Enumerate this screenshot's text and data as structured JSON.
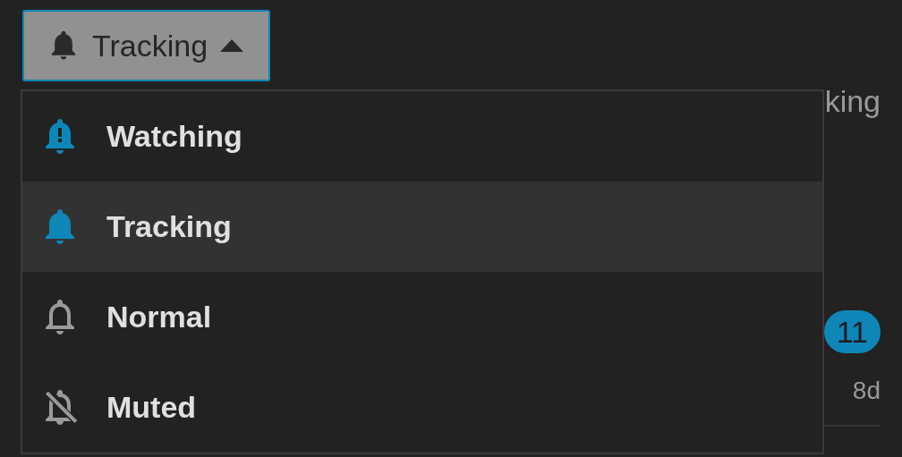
{
  "button": {
    "label": "Tracking",
    "kind": "tracking"
  },
  "menu": [
    {
      "label": "Watching",
      "kind": "watching",
      "selected": false
    },
    {
      "label": "Tracking",
      "kind": "tracking",
      "selected": true
    },
    {
      "label": "Normal",
      "kind": "normal",
      "selected": false
    },
    {
      "label": "Muted",
      "kind": "muted",
      "selected": false
    }
  ],
  "background": {
    "title_fragment": "king",
    "badge": "11",
    "age": "8d"
  }
}
